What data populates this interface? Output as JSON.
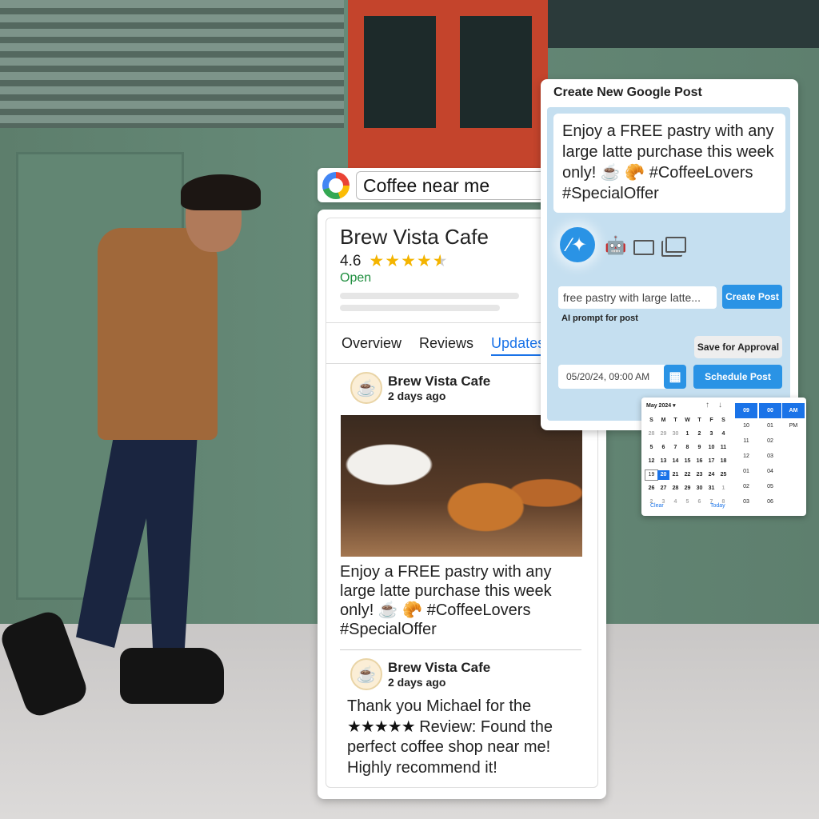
{
  "search": {
    "query": "Coffee near me"
  },
  "business": {
    "name": "Brew Vista Cafe",
    "rating": "4.6",
    "stars": 4.5,
    "status": "Open",
    "tabs": [
      "Overview",
      "Reviews",
      "Updates"
    ],
    "active_tab": "Updates"
  },
  "posts": [
    {
      "author": "Brew Vista Cafe",
      "time": "2 days ago",
      "text": "Enjoy a FREE pastry with any large latte purchase this week only! ☕ 🥐 #CoffeeLovers #SpecialOffer"
    },
    {
      "author": "Brew Vista Cafe",
      "time": "2 days ago",
      "stars": "★★★★★",
      "text_before": "Thank you Michael for the",
      "text_after": "Review: Found the perfect coffee shop near me! Highly recommend it!"
    }
  ],
  "create_post": {
    "title": "Create New Google Post",
    "content": "Enjoy a FREE pastry with any large latte purchase this week only! ☕ 🥐 #CoffeeLovers #SpecialOffer",
    "prompt_value": "free pastry with large latte...",
    "create_label": "Create Post",
    "prompt_label": "AI prompt for post",
    "save_label": "Save for Approval",
    "datetime": "05/20/24, 09:00 AM",
    "schedule_label": "Schedule Post",
    "icons": [
      "magic-wand-icon",
      "robot-icon",
      "image-icon",
      "gallery-icon"
    ]
  },
  "calendar": {
    "month": "May 2024 ▾",
    "weekdays": [
      "S",
      "M",
      "T",
      "W",
      "T",
      "F",
      "S"
    ],
    "days": [
      [
        "28",
        "29",
        "30",
        "1",
        "2",
        "3",
        "4"
      ],
      [
        "5",
        "6",
        "7",
        "8",
        "9",
        "10",
        "11"
      ],
      [
        "12",
        "13",
        "14",
        "15",
        "16",
        "17",
        "18"
      ],
      [
        "19",
        "20",
        "21",
        "22",
        "23",
        "24",
        "25"
      ],
      [
        "26",
        "27",
        "28",
        "29",
        "30",
        "31",
        "1"
      ],
      [
        "2",
        "3",
        "4",
        "5",
        "6",
        "7",
        "8"
      ]
    ],
    "today": "19",
    "selected": "20",
    "clear": "Clear",
    "today_label": "Today",
    "hours": [
      "09",
      "10",
      "11",
      "12",
      "01",
      "02",
      "03"
    ],
    "minutes": [
      "00",
      "01",
      "02",
      "03",
      "04",
      "05",
      "06"
    ],
    "ampm": [
      "AM",
      "PM"
    ]
  },
  "colors": {
    "accent": "#2a93e5",
    "open": "#1e8e3e",
    "star": "#f4b400",
    "panel_bg": "#c5dff0"
  }
}
